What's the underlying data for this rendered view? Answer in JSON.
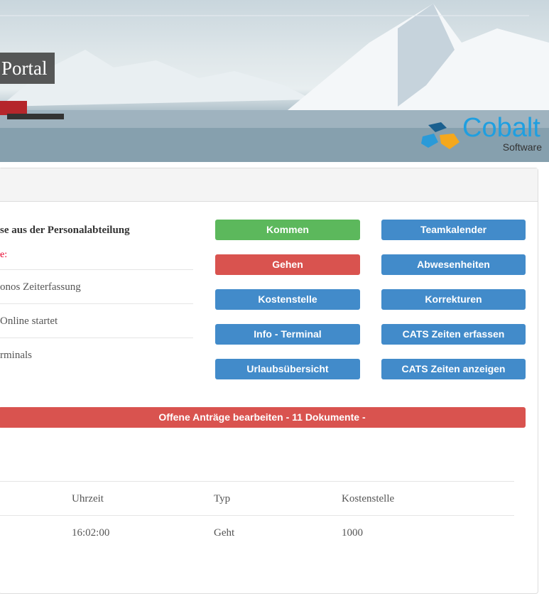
{
  "header": {
    "title": "Portal",
    "logo_name": "Cobalt",
    "logo_sub": "Software"
  },
  "news": {
    "heading": "se aus der Personalabteilung",
    "note": "e:",
    "items": [
      "onos Zeiterfassung",
      " Online startet",
      "rminals"
    ]
  },
  "buttons": {
    "kommen": "Kommen",
    "gehen": "Gehen",
    "kostenstelle": "Kostenstelle",
    "info": "Info - Terminal",
    "urlaub": "Urlaubsübersicht",
    "teamkalender": "Teamkalender",
    "abwesenheiten": "Abwesenheiten",
    "korrekturen": "Korrekturen",
    "cats_erfassen": "CATS Zeiten erfassen",
    "cats_anzeigen": "CATS Zeiten anzeigen",
    "offene": "Offene Anträge bearbeiten - 11 Dokumente -"
  },
  "colors": {
    "success": "#5cb85c",
    "danger": "#d9534f",
    "primary": "#428bca"
  },
  "table": {
    "headers": [
      "Uhrzeit",
      "Typ",
      "Kostenstelle"
    ],
    "rows": [
      [
        "16:02:00",
        "Geht",
        "1000"
      ]
    ]
  }
}
